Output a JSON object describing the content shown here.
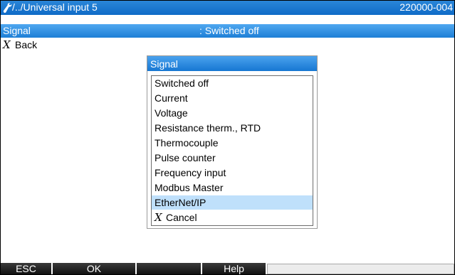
{
  "title_bar": {
    "path": "/../Universal input 5",
    "device_id": "220000-004",
    "icon": "wrench-icon"
  },
  "selected_parameter": {
    "name": "Signal",
    "value": ": Switched off"
  },
  "back": {
    "icon": "x-icon",
    "label": "Back"
  },
  "dialog": {
    "title": "Signal",
    "options": [
      {
        "label": "Switched off",
        "highlighted": false
      },
      {
        "label": "Current",
        "highlighted": false
      },
      {
        "label": "Voltage",
        "highlighted": false
      },
      {
        "label": "Resistance therm., RTD",
        "highlighted": false
      },
      {
        "label": "Thermocouple",
        "highlighted": false
      },
      {
        "label": "Pulse counter",
        "highlighted": false
      },
      {
        "label": "Frequency input",
        "highlighted": false
      },
      {
        "label": "Modbus Master",
        "highlighted": false
      },
      {
        "label": "EtherNet/IP",
        "highlighted": true
      }
    ],
    "cancel": {
      "icon": "x-icon",
      "label": "Cancel"
    }
  },
  "softkeys": {
    "esc": "ESC",
    "ok": "OK",
    "key3": "",
    "help": "Help"
  },
  "colors": {
    "title_bar": "#0f6bc7",
    "selection": "#1d7fd6",
    "highlight": "#bfe0fb",
    "softkey": "#111111"
  }
}
